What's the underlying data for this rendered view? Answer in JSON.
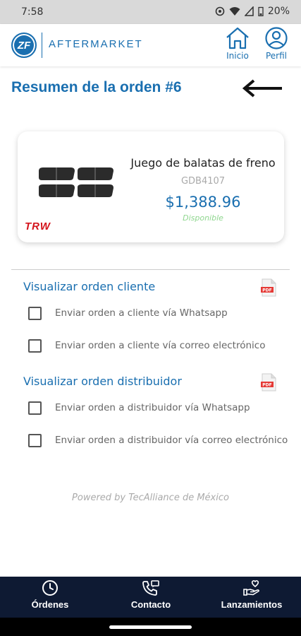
{
  "status_bar": {
    "time": "7:58",
    "battery": "20%"
  },
  "header": {
    "logo_text": "ZF",
    "brand": "AFTERMARKET",
    "nav": {
      "inicio": "Inicio",
      "perfil": "Perfil"
    }
  },
  "page": {
    "title": "Resumen de la orden #6"
  },
  "product": {
    "name": "Juego de balatas de freno",
    "code": "GDB4107",
    "price": "$1,388.96",
    "status": "Disponible",
    "brand_logo": "TRW"
  },
  "sections": [
    {
      "title": "Visualizar orden cliente",
      "options": [
        "Enviar orden a cliente vía Whatsapp",
        "Enviar orden a cliente vía correo electrónico"
      ]
    },
    {
      "title": "Visualizar orden distribuidor",
      "options": [
        "Enviar orden a distribuidor vía Whatsapp",
        "Enviar orden a distribuidor vía correo electrónico"
      ]
    }
  ],
  "pdf_label": "PDF",
  "footer": {
    "powered_by": "Powered by TecAlliance de México"
  },
  "bottom_nav": {
    "ordenes": "Órdenes",
    "contacto": "Contacto",
    "lanzamientos": "Lanzamientos"
  },
  "colors": {
    "brand_blue": "#1a6fb0",
    "nav_dark": "#0e1a33",
    "trw_red": "#d4141c",
    "status_green": "#8fd68f"
  }
}
